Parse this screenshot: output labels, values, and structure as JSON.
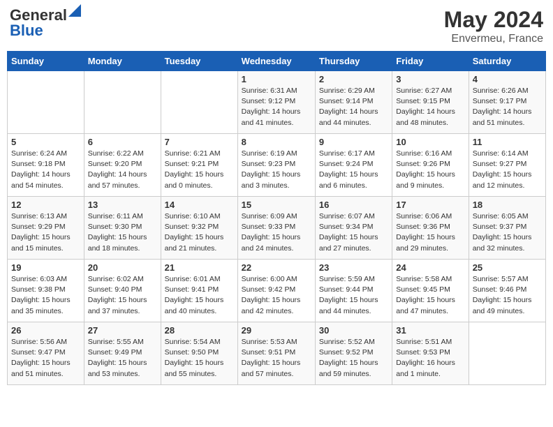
{
  "header": {
    "logo_general": "General",
    "logo_blue": "Blue",
    "month": "May 2024",
    "location": "Envermeu, France"
  },
  "days_of_week": [
    "Sunday",
    "Monday",
    "Tuesday",
    "Wednesday",
    "Thursday",
    "Friday",
    "Saturday"
  ],
  "weeks": [
    [
      {
        "day": "",
        "info": ""
      },
      {
        "day": "",
        "info": ""
      },
      {
        "day": "",
        "info": ""
      },
      {
        "day": "1",
        "info": "Sunrise: 6:31 AM\nSunset: 9:12 PM\nDaylight: 14 hours\nand 41 minutes."
      },
      {
        "day": "2",
        "info": "Sunrise: 6:29 AM\nSunset: 9:14 PM\nDaylight: 14 hours\nand 44 minutes."
      },
      {
        "day": "3",
        "info": "Sunrise: 6:27 AM\nSunset: 9:15 PM\nDaylight: 14 hours\nand 48 minutes."
      },
      {
        "day": "4",
        "info": "Sunrise: 6:26 AM\nSunset: 9:17 PM\nDaylight: 14 hours\nand 51 minutes."
      }
    ],
    [
      {
        "day": "5",
        "info": "Sunrise: 6:24 AM\nSunset: 9:18 PM\nDaylight: 14 hours\nand 54 minutes."
      },
      {
        "day": "6",
        "info": "Sunrise: 6:22 AM\nSunset: 9:20 PM\nDaylight: 14 hours\nand 57 minutes."
      },
      {
        "day": "7",
        "info": "Sunrise: 6:21 AM\nSunset: 9:21 PM\nDaylight: 15 hours\nand 0 minutes."
      },
      {
        "day": "8",
        "info": "Sunrise: 6:19 AM\nSunset: 9:23 PM\nDaylight: 15 hours\nand 3 minutes."
      },
      {
        "day": "9",
        "info": "Sunrise: 6:17 AM\nSunset: 9:24 PM\nDaylight: 15 hours\nand 6 minutes."
      },
      {
        "day": "10",
        "info": "Sunrise: 6:16 AM\nSunset: 9:26 PM\nDaylight: 15 hours\nand 9 minutes."
      },
      {
        "day": "11",
        "info": "Sunrise: 6:14 AM\nSunset: 9:27 PM\nDaylight: 15 hours\nand 12 minutes."
      }
    ],
    [
      {
        "day": "12",
        "info": "Sunrise: 6:13 AM\nSunset: 9:29 PM\nDaylight: 15 hours\nand 15 minutes."
      },
      {
        "day": "13",
        "info": "Sunrise: 6:11 AM\nSunset: 9:30 PM\nDaylight: 15 hours\nand 18 minutes."
      },
      {
        "day": "14",
        "info": "Sunrise: 6:10 AM\nSunset: 9:32 PM\nDaylight: 15 hours\nand 21 minutes."
      },
      {
        "day": "15",
        "info": "Sunrise: 6:09 AM\nSunset: 9:33 PM\nDaylight: 15 hours\nand 24 minutes."
      },
      {
        "day": "16",
        "info": "Sunrise: 6:07 AM\nSunset: 9:34 PM\nDaylight: 15 hours\nand 27 minutes."
      },
      {
        "day": "17",
        "info": "Sunrise: 6:06 AM\nSunset: 9:36 PM\nDaylight: 15 hours\nand 29 minutes."
      },
      {
        "day": "18",
        "info": "Sunrise: 6:05 AM\nSunset: 9:37 PM\nDaylight: 15 hours\nand 32 minutes."
      }
    ],
    [
      {
        "day": "19",
        "info": "Sunrise: 6:03 AM\nSunset: 9:38 PM\nDaylight: 15 hours\nand 35 minutes."
      },
      {
        "day": "20",
        "info": "Sunrise: 6:02 AM\nSunset: 9:40 PM\nDaylight: 15 hours\nand 37 minutes."
      },
      {
        "day": "21",
        "info": "Sunrise: 6:01 AM\nSunset: 9:41 PM\nDaylight: 15 hours\nand 40 minutes."
      },
      {
        "day": "22",
        "info": "Sunrise: 6:00 AM\nSunset: 9:42 PM\nDaylight: 15 hours\nand 42 minutes."
      },
      {
        "day": "23",
        "info": "Sunrise: 5:59 AM\nSunset: 9:44 PM\nDaylight: 15 hours\nand 44 minutes."
      },
      {
        "day": "24",
        "info": "Sunrise: 5:58 AM\nSunset: 9:45 PM\nDaylight: 15 hours\nand 47 minutes."
      },
      {
        "day": "25",
        "info": "Sunrise: 5:57 AM\nSunset: 9:46 PM\nDaylight: 15 hours\nand 49 minutes."
      }
    ],
    [
      {
        "day": "26",
        "info": "Sunrise: 5:56 AM\nSunset: 9:47 PM\nDaylight: 15 hours\nand 51 minutes."
      },
      {
        "day": "27",
        "info": "Sunrise: 5:55 AM\nSunset: 9:49 PM\nDaylight: 15 hours\nand 53 minutes."
      },
      {
        "day": "28",
        "info": "Sunrise: 5:54 AM\nSunset: 9:50 PM\nDaylight: 15 hours\nand 55 minutes."
      },
      {
        "day": "29",
        "info": "Sunrise: 5:53 AM\nSunset: 9:51 PM\nDaylight: 15 hours\nand 57 minutes."
      },
      {
        "day": "30",
        "info": "Sunrise: 5:52 AM\nSunset: 9:52 PM\nDaylight: 15 hours\nand 59 minutes."
      },
      {
        "day": "31",
        "info": "Sunrise: 5:51 AM\nSunset: 9:53 PM\nDaylight: 16 hours\nand 1 minute."
      },
      {
        "day": "",
        "info": ""
      }
    ]
  ]
}
